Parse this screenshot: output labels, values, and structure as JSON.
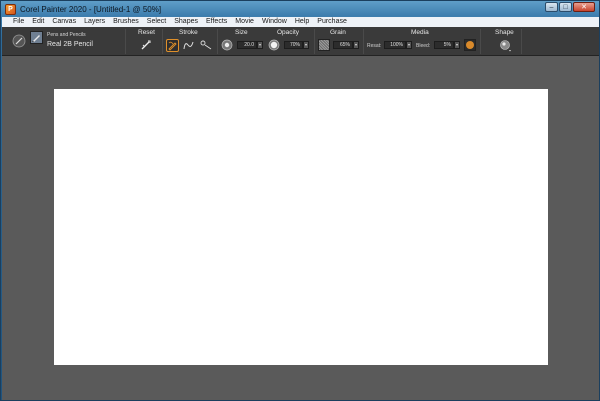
{
  "window": {
    "title": "Corel Painter 2020 - [Untitled-1 @ 50%]",
    "app_icon_glyph": "P",
    "controls": {
      "minimize": "–",
      "maximize": "□",
      "close": "✕"
    }
  },
  "menu": {
    "items": [
      "File",
      "Edit",
      "Canvas",
      "Layers",
      "Brushes",
      "Select",
      "Shapes",
      "Effects",
      "Movie",
      "Window",
      "Help",
      "Purchase"
    ]
  },
  "property_bar": {
    "brush": {
      "category": "Pens and Pencils",
      "variant": "Real 2B Pencil"
    },
    "reset": {
      "label": "Reset"
    },
    "stroke": {
      "label": "Stroke"
    },
    "size": {
      "label": "Size",
      "value": "20.0"
    },
    "opacity": {
      "label": "Opacity",
      "value": "70%"
    },
    "grain": {
      "label": "Grain",
      "value": "65%"
    },
    "media": {
      "label": "Media",
      "resat_label": "Resat:",
      "resat_value": "100%",
      "bleed_label": "Bleed:",
      "bleed_value": "5%"
    },
    "shape": {
      "label": "Shape"
    },
    "dropdown_glyph": "▾"
  },
  "colors": {
    "workspace": "#5a5a5a",
    "property_bar": "#3a3a3a",
    "active_stroke_border": "#e0902a"
  }
}
